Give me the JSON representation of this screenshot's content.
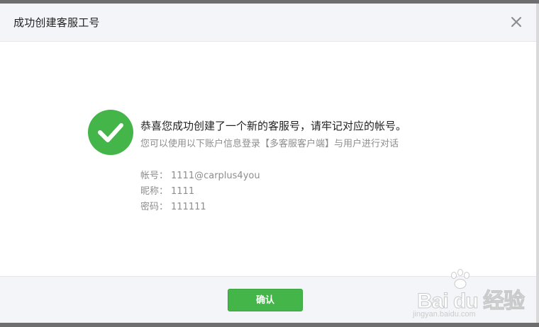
{
  "dialog": {
    "title": "成功创建客服工号",
    "close_icon": "close-icon"
  },
  "body": {
    "success_icon": "check-circle-icon",
    "success_color": "#44b549",
    "main_message": "恭喜您成功创建了一个新的客服号，请牢记对应的帐号。",
    "sub_message": "您可以使用以下账户信息登录【多客服客户端】与用户进行对话",
    "account_label": "帐号：",
    "account_value": "1111@carplus4you",
    "nickname_label": "昵称：",
    "nickname_value": "1111",
    "password_label": "密码：",
    "password_value": "111111"
  },
  "footer": {
    "confirm_label": "确认"
  },
  "watermark": {
    "brand": "Bai du 经验",
    "url": "jingyan.baidu.com"
  }
}
